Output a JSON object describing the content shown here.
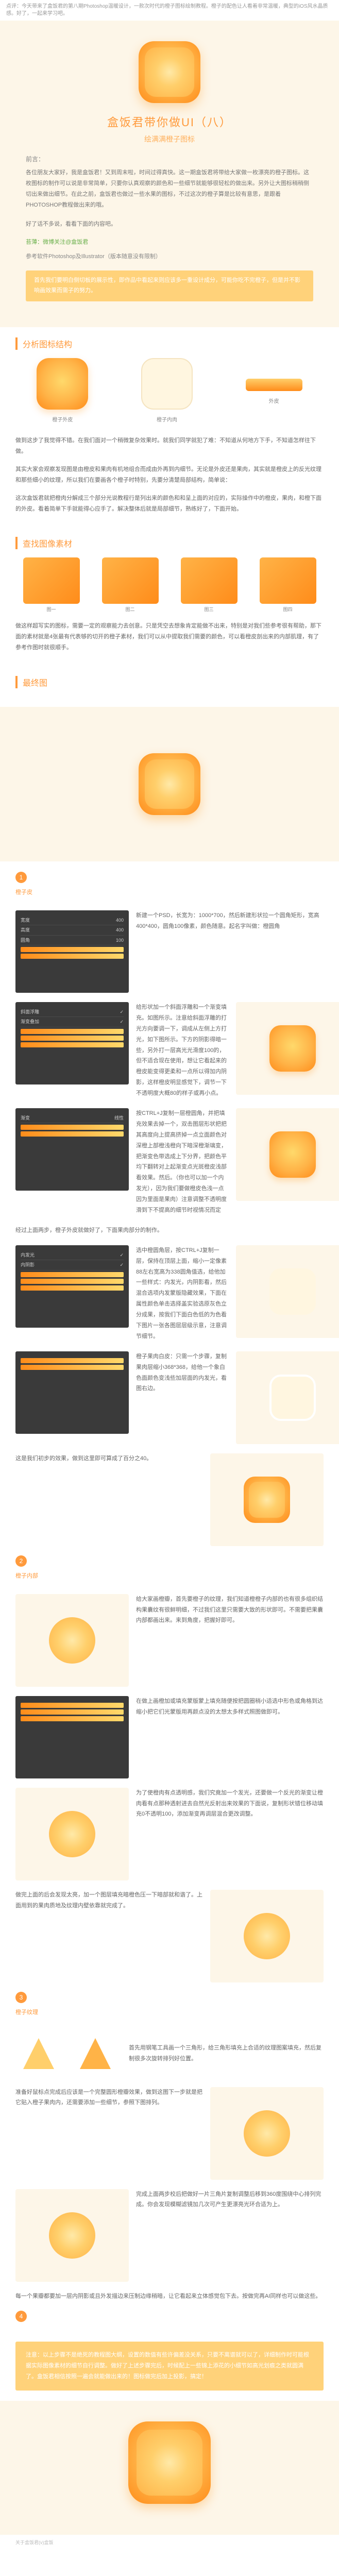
{
  "meta_top": "点评：今天带来了盒饭君的第八期Photoshop温暖设计，一款次时代的橙子图标绘制教程。橙子的配色让人看着非常温暖，典型的iOS风水晶质感。好了，一起来学习吧。",
  "hero": {
    "title": "盒饭君带你做UI（八）",
    "subtitle": "绘满满橙子图标"
  },
  "intro_label": "前言：",
  "intro_p1": "各位朋友大家好，我是盒饭君！又到周末啦，时间过得真快。这一期盒饭君将带给大家做一枚漂亮的橙子图标。这枚图标的制作可以说是非常简单，只要你认真观察的颜色和一些细节就能够很轻松的做出来。另外让大图标稍稍侧切出来做出细节。在此之前，盒饭君也做过一些水果的图标，不过这次的橙子算是比较有意思，是跟着PHOTOSHOP教程做出来的哦。",
  "intro_p2": "好了话不多说，看看下面的内容吧。",
  "moss": "苔薄：微博关注@盒饭君",
  "version": "参考软件Photoshop及Illustrator（版本随意没有限制）",
  "hint_box": "首先我们要明白侧切板的展示性，即作品中看起来则应该多一重设计成分，可能你吃不完橙子，但是并不影响画效果而需子的努力。",
  "section_struct": {
    "title": "分析图标结构",
    "caps": {
      "a": "橙子外皮",
      "b": "橙子内肉",
      "c": "外皮"
    },
    "p1": "做到这步了我觉得不错。在我们面对一个稍微复杂效果时。就我们同学就犯了难：不知道从何地方下手，不知道怎样往下做。",
    "p2": "其实大家会观察发现图是由橙皮和果肉有机地组合而成由外再到内细节。无论是外皮还是果肉，其实就是橙皮上的反光纹理和那些细小的纹理，所以我们在要画各个橙子时特别，先要分清楚局部结构，简单说：",
    "p3": "这次盒饭君就把橙肉分解成三个部分光说教程行是列出来的颜色和和呈上面的对应的，实际操作中的橙皮，果肉，和橙下面的外皮。看着简单下手就能得心应手了。解决整体后就是局部细节，熟练好了，下面开始。"
  },
  "section_refs": {
    "title": "查找图像素材",
    "caps": {
      "a": "图一",
      "b": "图二",
      "c": "图三",
      "d": "图四"
    },
    "p1": "做这样超写实的图标，需要一定的观察能力去创意。只是凭空去想象肯定能做不出来，特别是对我们些参考很有帮助，那下面的素材就是4张最有代表够的切开的橙子素材，我们可以从中提取我们需要的颜色，可以看橙皮剖出来的内部肌理，有了参考作图时就很顺手。"
  },
  "section_preview": {
    "title": "最终图"
  },
  "steps": {
    "s1": {
      "title": "橙子皮",
      "t1": "新建一个PSD，长宽为：1000*700，然后新建形状拉一个圆角矩形，宽高400*400，圆角100像素，颜色随意。起名字叫做：橙圆角",
      "t2": "给形状加一个斜面浮雕和一个渐变填充。如图所示。注意给斜面浮雕的打光方向要调一下，调成从左侧上方打光，如下图所示。下方的阴影得暗一些，另外打一层高光光滑度100的，但不适合现在使用，想让它看起来的橙皮能变得更柔和一点所以得加内阴影，这样橙皮明显感觉下，调节一下不透明度大概80的样子或再小点。"
    },
    "s2": "按CTRL+J复制一层橙圆角，并把填充效果去掉一个，双击图层形状把把其高度向上提高挤掉一点立面颜色对深橙上部橙浅橙向下暗深橙渐璃变，把渐变色带选成上下分界，把颜色平均下翻转对上起渐变点光斑橙皮浅部看效果。然后。（你也可以加一个内发光），因为我们要做橙皮色浅一点因为里面是果肉）注意调整不透明度滑到下不提高的细节时视情况而定",
    "s3": {
      "t1": "经过上面两步，橙子外皮就做好了，下面果肉部分的制作。",
      "t2": "选中橙圆角层，按CTRL+J复制一层，保持在顶层上面，缩小一定像素88左右宽高为338圆角值选，给他加一些样式：内发光，内阴影看，然后混合选项内发蒙版隐藏效果，下面在属性颜色单击选择盖实验选原灰色立分成果，按我们下面白色低的为色看下图片一张各图层层级示意，注意调节细节。"
    },
    "s4": "橙子果肉白皮：只需一个步骤，复制果肉层缩小368*368，给他一个象白色面颜色变浅些加层面的内发光，看图右边。",
    "s5": "这是我们初步的效果，做到这里即可算成了百分之40。",
    "s6_title": "橙子内部",
    "s6": "给大家画橙瓣，首先要橙子的纹理，我们知道橙橙子内部的也有很多组织结构果囊纹有很鲜明细，不过我们这里只需要大致的形状即可。不需要把果囊内部都画出来。来到角度，把握好即可。",
    "s7": "在做上画橙加或填充蒙版蒙上填充随便按把圆圈稍小适选中形色或角格到达缩小把它们光蒙版用再颜点没的太想太多样式照图做即可。",
    "s8": "为了使橙肉有点透明感，我们究竟加一个发光，还要做一个反光的渐变让橙肉看有点那种透射进去自然光反射出来效果的下面说，复制形状错位移动填充0不透明100，添加渐变再调层混合更改调整。",
    "s9": "做完上面的后会发现太亮，加一个图层填充暗橙色压一下暗部就和谐了。上面用到的果肉质地及纹理内壁依靠就完成了。",
    "s10_title": "橙子纹理",
    "s10": "首先用钢笔工具画一个三角形，给三角形填充上合适的纹理图案填充，然后复制很多次旋转排列好位置。",
    "s11": "准备好鼠标点完成后应该是一个完整圆形橙瓣效果，做到这图下一步就是把它贴入橙子果肉内，还需要添加一些细节，参照下图排列。",
    "s12": "完成上面两步校后把做好一片三角片复制调整后移到360度围绕中心排列完成。你会发现模糊滤镜加几次可产生更漂亮光环合适为上。",
    "s13": "每一个果瓣都要加一层内阴影或且外发描边来压制边缘稍暗，让它看起来立体感觉包下去。按做完再AI同样也可以做这些。"
  },
  "summary": "注意：以上步骤不是绝死的教程图大纲，设置的数值有些许偏差没关系，只要不离谱就可以了，详细制作时可能根据实际图像素材的细节自行调整。做好了上述步骤完后，时候配上一些锦上添花的小细节如高光划痕之类就圆满了。盒饭君相信按照一遍会就能做出来的！图标做完后加上投影，搞定！",
  "footer": "关于盒饭君(v)盒饭"
}
